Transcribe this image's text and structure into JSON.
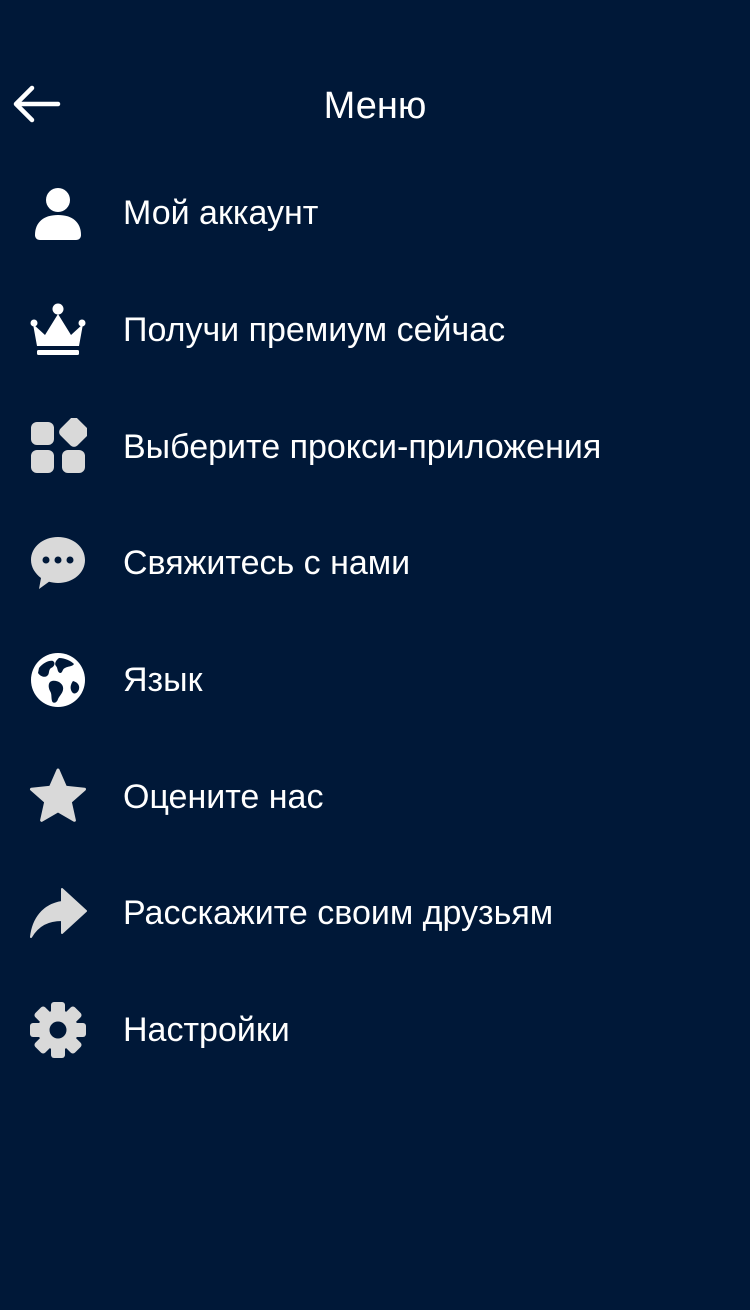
{
  "header": {
    "title": "Меню",
    "back_icon": "arrow-left-icon"
  },
  "colors": {
    "background": "#001838",
    "text": "#ffffff",
    "icon": "#d9d9d9"
  },
  "menu": {
    "items": [
      {
        "label": "Мой аккаунт",
        "icon": "user-icon"
      },
      {
        "label": "Получи премиум сейчас",
        "icon": "crown-icon"
      },
      {
        "label": "Выберите прокси-приложения",
        "icon": "apps-grid-icon"
      },
      {
        "label": "Свяжитесь с нами",
        "icon": "chat-bubble-icon"
      },
      {
        "label": "Язык",
        "icon": "globe-icon"
      },
      {
        "label": "Оцените нас",
        "icon": "star-icon"
      },
      {
        "label": "Расскажите своим друзьям",
        "icon": "share-icon"
      },
      {
        "label": "Настройки",
        "icon": "gear-icon"
      }
    ]
  }
}
